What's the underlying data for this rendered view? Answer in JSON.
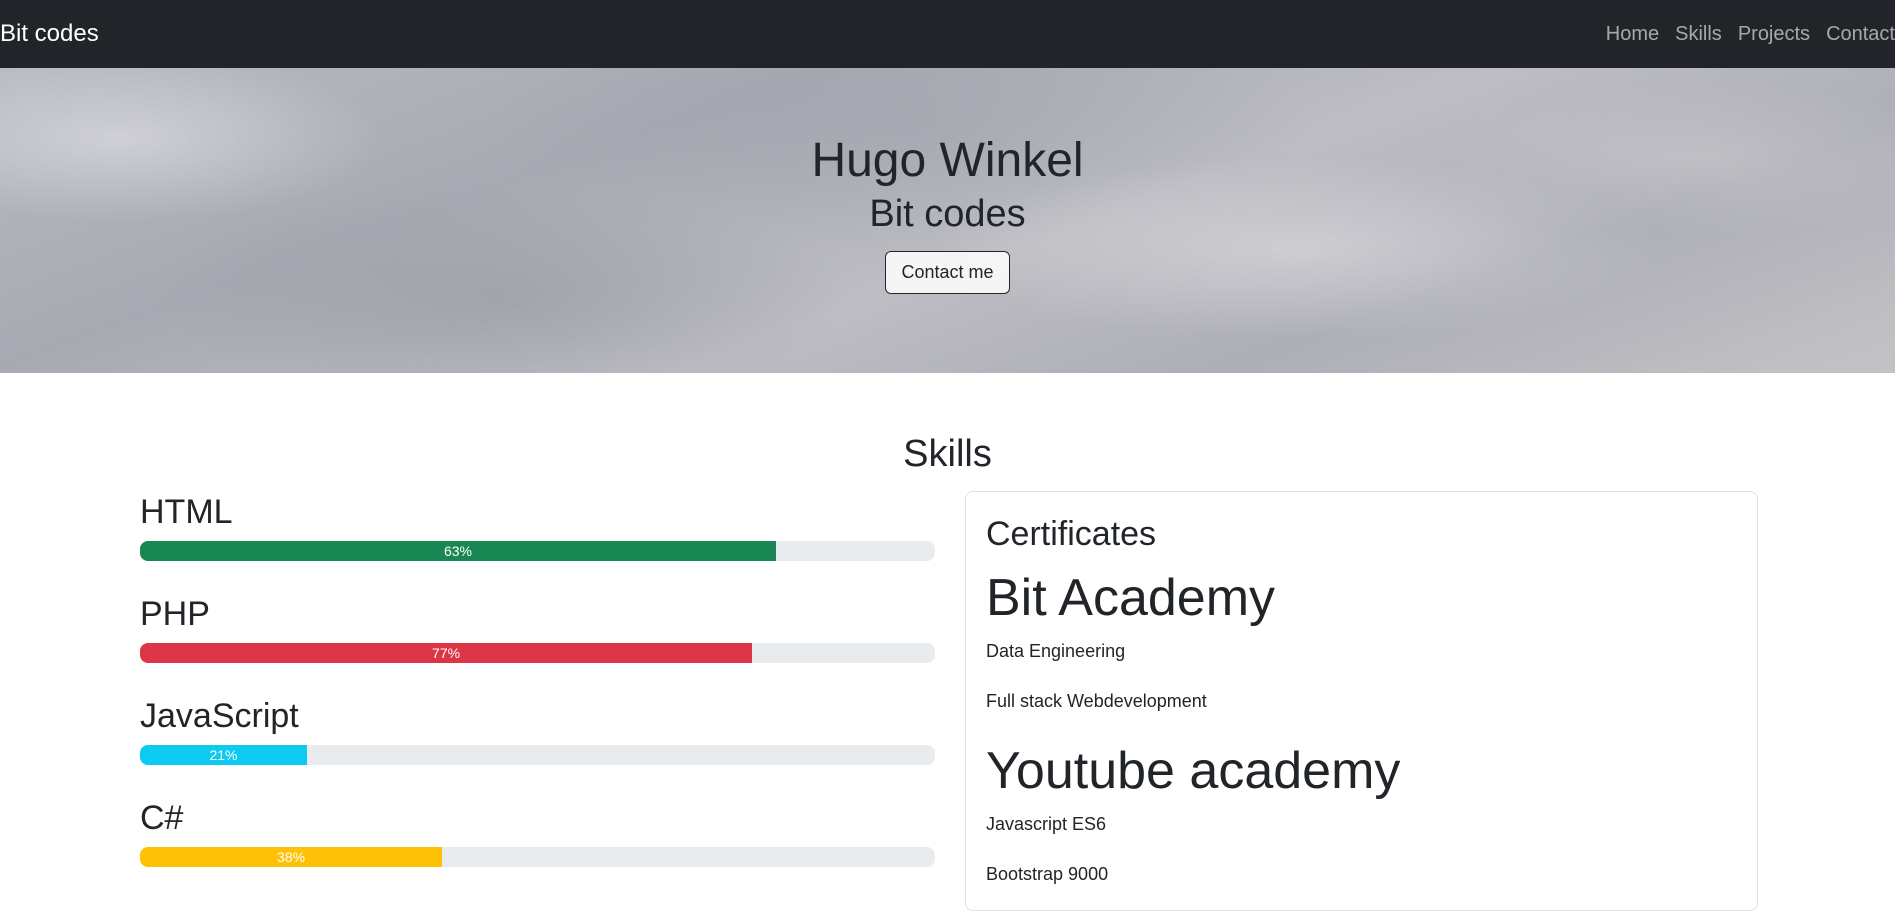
{
  "navbar": {
    "brand": "Bit codes",
    "links": [
      "Home",
      "Skills",
      "Projects",
      "Contact"
    ]
  },
  "hero": {
    "name": "Hugo Winkel",
    "subtitle": "Bit codes",
    "button_label": "Contact me"
  },
  "skills": {
    "title": "Skills",
    "items": [
      {
        "name": "HTML",
        "label": "63%",
        "fill_fraction": 0.8,
        "color": "#198754"
      },
      {
        "name": "PHP",
        "label": "77%",
        "fill_fraction": 0.77,
        "color": "#dc3545"
      },
      {
        "name": "JavaScript",
        "label": "21%",
        "fill_fraction": 0.21,
        "color": "#0dcaf0"
      },
      {
        "name": "C#",
        "label": "38%",
        "fill_fraction": 0.38,
        "color": "#ffc107"
      }
    ]
  },
  "certificates": {
    "title": "Certificates",
    "groups": [
      {
        "name": "Bit Academy",
        "items": [
          "Data Engineering",
          "Full stack Webdevelopment"
        ]
      },
      {
        "name": "Youtube academy",
        "items": [
          "Javascript ES6",
          "Bootstrap 9000"
        ]
      }
    ]
  }
}
